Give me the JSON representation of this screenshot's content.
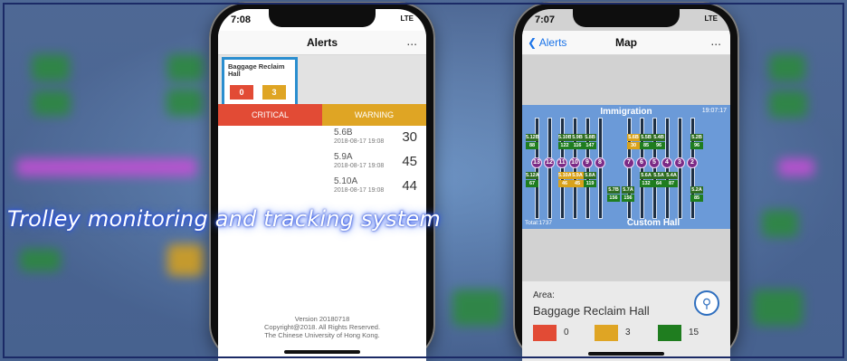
{
  "caption": "Trolley monitoring and tracking system",
  "colors": {
    "critical": "#e24b35",
    "warning": "#dfa524",
    "ok": "#1f7d1f",
    "link": "#1a73e8"
  },
  "left_phone": {
    "time": "7:08",
    "signal": "LTE",
    "title": "Alerts",
    "more": "...",
    "area_name": "Baggage Reclaim Hall",
    "area_critical": "0",
    "area_warning": "3",
    "tab_critical": "CRITICAL",
    "tab_warning": "WARNING",
    "alerts": [
      {
        "code": "5.6B",
        "time": "2018-08-17 19:08",
        "count": "30"
      },
      {
        "code": "5.9A",
        "time": "2018-08-17 19:08",
        "count": "45"
      },
      {
        "code": "5.10A",
        "time": "2018-08-17 19:08",
        "count": "44"
      }
    ],
    "footer_version": "Version 20180718",
    "footer_copy": "Copyright@2018. All Rights Reserved.",
    "footer_org": "The Chinese University of Hong Kong."
  },
  "right_phone": {
    "time": "7:07",
    "signal": "LTE",
    "back_label": "Alerts",
    "title": "Map",
    "more": "...",
    "map_top": "Immigration",
    "map_clock": "19:07:17",
    "map_total": "Total:1737",
    "map_bottom": "Custom Hall",
    "belt_numbers": [
      "13",
      "12",
      "11",
      "10",
      "9",
      "8",
      "7",
      "6",
      "5",
      "4",
      "3",
      "2"
    ],
    "top_gates": [
      {
        "label": "5.12B",
        "value": "88",
        "warn": false
      },
      {
        "label": "5.10B",
        "value": "122",
        "warn": false
      },
      {
        "label": "5.9B",
        "value": "116",
        "warn": false
      },
      {
        "label": "5.8B",
        "value": "147",
        "warn": false
      },
      {
        "label": "5.6B",
        "value": "30",
        "warn": true
      },
      {
        "label": "5.5B",
        "value": "85",
        "warn": false
      },
      {
        "label": "5.4B",
        "value": "96",
        "warn": false
      },
      {
        "label": "5.2B",
        "value": "96",
        "warn": false
      }
    ],
    "bottom_gates": [
      {
        "label": "5.12A",
        "value": "67",
        "warn": false
      },
      {
        "label": "5.10A",
        "value": "46",
        "warn": true
      },
      {
        "label": "5.9A",
        "value": "45",
        "warn": true
      },
      {
        "label": "5.8A",
        "value": "119",
        "warn": false
      },
      {
        "label": "5.7B",
        "value": "156",
        "warn": false
      },
      {
        "label": "5.7A",
        "value": "156",
        "warn": false
      },
      {
        "label": "5.6A",
        "value": "132",
        "warn": false
      },
      {
        "label": "5.5A",
        "value": "64",
        "warn": false
      },
      {
        "label": "5.4A",
        "value": "87",
        "warn": false
      },
      {
        "label": "5.2A",
        "value": "85",
        "warn": false
      }
    ],
    "area_label": "Area:",
    "area_name": "Baggage Reclaim Hall",
    "counts": {
      "critical": "0",
      "warning": "3",
      "ok": "15"
    }
  }
}
